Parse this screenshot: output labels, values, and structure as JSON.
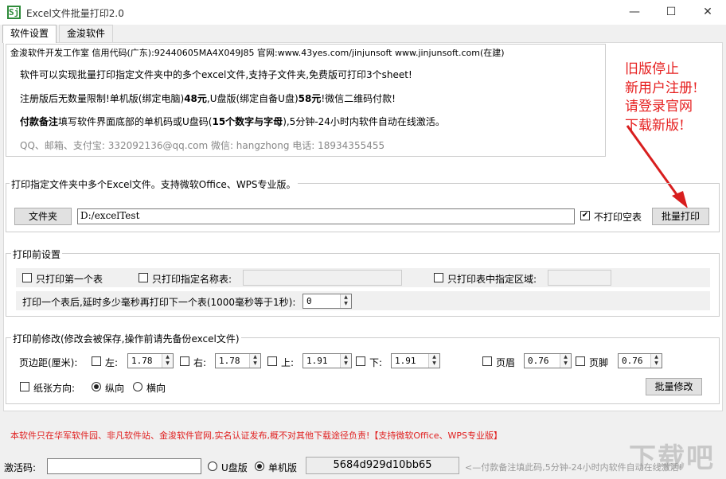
{
  "window": {
    "title": "Excel文件批量打印2.0",
    "app_icon_glyph": "Sj",
    "minimize_glyph": "—",
    "maximize_glyph": "☐",
    "close_glyph": "✕"
  },
  "tabs": [
    {
      "label": "软件设置"
    },
    {
      "label": "金浚软件"
    }
  ],
  "info": {
    "line1": "金浚软件开发工作室 信用代码(广东):92440605MA4X049J85 官网:www.43yes.com/jinjunsoft  www.jinjunsoft.com(在建)",
    "line2": "软件可以实现批量打印指定文件夹中的多个excel文件,支持子文件夹,免费版可打印3个sheet!",
    "line3_a": "注册版后无数量限制!单机版(绑定电脑)",
    "line3_b": "48元",
    "line3_c": ",U盘版(绑定自备U盘)",
    "line3_d": "58元",
    "line3_e": "!微信二维码付款!",
    "line4_a": "付款备注",
    "line4_b": "填写软件界面底部的单机码或U盘码(",
    "line4_c": "15个数字与字母",
    "line4_d": "),5分钟-24小时内软件自动在线激活。",
    "line5": "QQ、邮箱、支付宝: 332092136@qq.com    微信: hangzhong    电话: 18934355455"
  },
  "notice": {
    "lines": [
      "旧版停止",
      "新用户注册!",
      "请登录官网",
      "下载新版!"
    ]
  },
  "print_group": {
    "legend": "打印指定文件夹中多个Excel文件。支持微软Office、WPS专业版。",
    "folder_button": "文件夹",
    "path_value": "D:/excelTest",
    "skip_empty_label": "不打印空表",
    "skip_empty_checked": true,
    "batch_print_button": "批量打印"
  },
  "pre_settings": {
    "legend": "打印前设置",
    "first_sheet_label": "只打印第一个表",
    "named_sheet_label": "只打印指定名称表:",
    "region_label": "只打印表中指定区域:",
    "delay_label": "打印一个表后,延时多少毫秒再打印下一个表(1000毫秒等于1秒):",
    "delay_value": "0"
  },
  "pre_modify": {
    "legend": "打印前修改(修改会被保存,操作前请先备份excel文件)",
    "margin_label": "页边距(厘米):",
    "left_label": "左:",
    "left_value": "1.78",
    "right_label": "右:",
    "right_value": "1.78",
    "top_label": "上:",
    "top_value": "1.91",
    "bottom_label": "下:",
    "bottom_value": "1.91",
    "header_label": "页眉",
    "header_value": "0.76",
    "footer_label": "页脚",
    "footer_value": "0.76",
    "orientation_label": "纸张方向:",
    "portrait_label": "纵向",
    "landscape_label": "横向",
    "batch_modify_button": "批量修改"
  },
  "disclaimer": "本软件只在华军软件园、非凡软件站、金浚软件官网,实名认证发布,概不对其他下载途径负责!【支持微软Office、WPS专业版】",
  "status": {
    "activation_label": "激活码:",
    "usb_label": "U盘版",
    "standalone_label": "单机版",
    "machine_code": "5684d929d10bb65",
    "hint": "<—付款备注填此码,5分钟-24小时内软件自动在线激活!"
  },
  "watermark": "下载吧",
  "colors": {
    "accent_red": "#e02020",
    "notice_red": "#e62020",
    "arrow_red": "#d81e1e"
  }
}
